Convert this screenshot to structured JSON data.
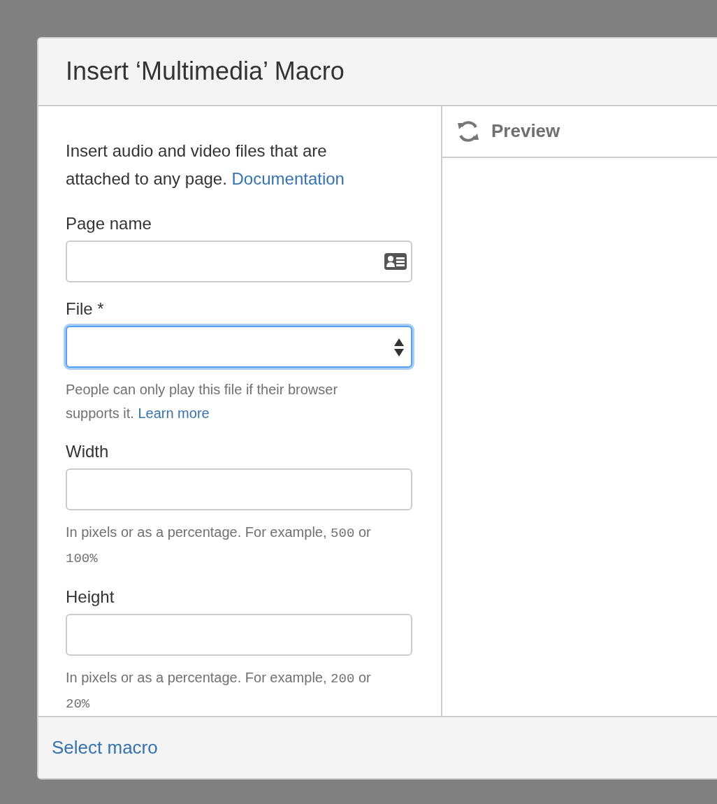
{
  "dialog": {
    "title": "Insert ‘Multimedia’ Macro"
  },
  "description": {
    "text": "Insert audio and video files that are attached to any page.",
    "link": "Documentation"
  },
  "fields": [
    {
      "kind": "page",
      "label": "Page name",
      "focused": false
    },
    {
      "kind": "select",
      "label": "File *",
      "focused": true,
      "hint": {
        "text": "People can only play this file if their browser supports it.",
        "link": "Learn more"
      }
    },
    {
      "kind": "text",
      "label": "Width",
      "focused": false,
      "hint": {
        "segments": [
          {
            "kind": "text",
            "text": "In pixels or as a percentage. For example,"
          },
          {
            "kind": "code",
            "text": "500"
          },
          {
            "kind": "text",
            "text": "or"
          },
          {
            "kind": "code",
            "text": "100%"
          }
        ]
      }
    },
    {
      "kind": "text",
      "label": "Height",
      "focused": false,
      "hint": {
        "segments": [
          {
            "kind": "text",
            "text": "In pixels or as a percentage. For example,"
          },
          {
            "kind": "code",
            "text": "200"
          },
          {
            "kind": "text",
            "text": "or"
          },
          {
            "kind": "code",
            "text": "20%"
          }
        ]
      }
    }
  ],
  "preview": {
    "title": "Preview"
  },
  "footer": {
    "link": "Select macro"
  }
}
